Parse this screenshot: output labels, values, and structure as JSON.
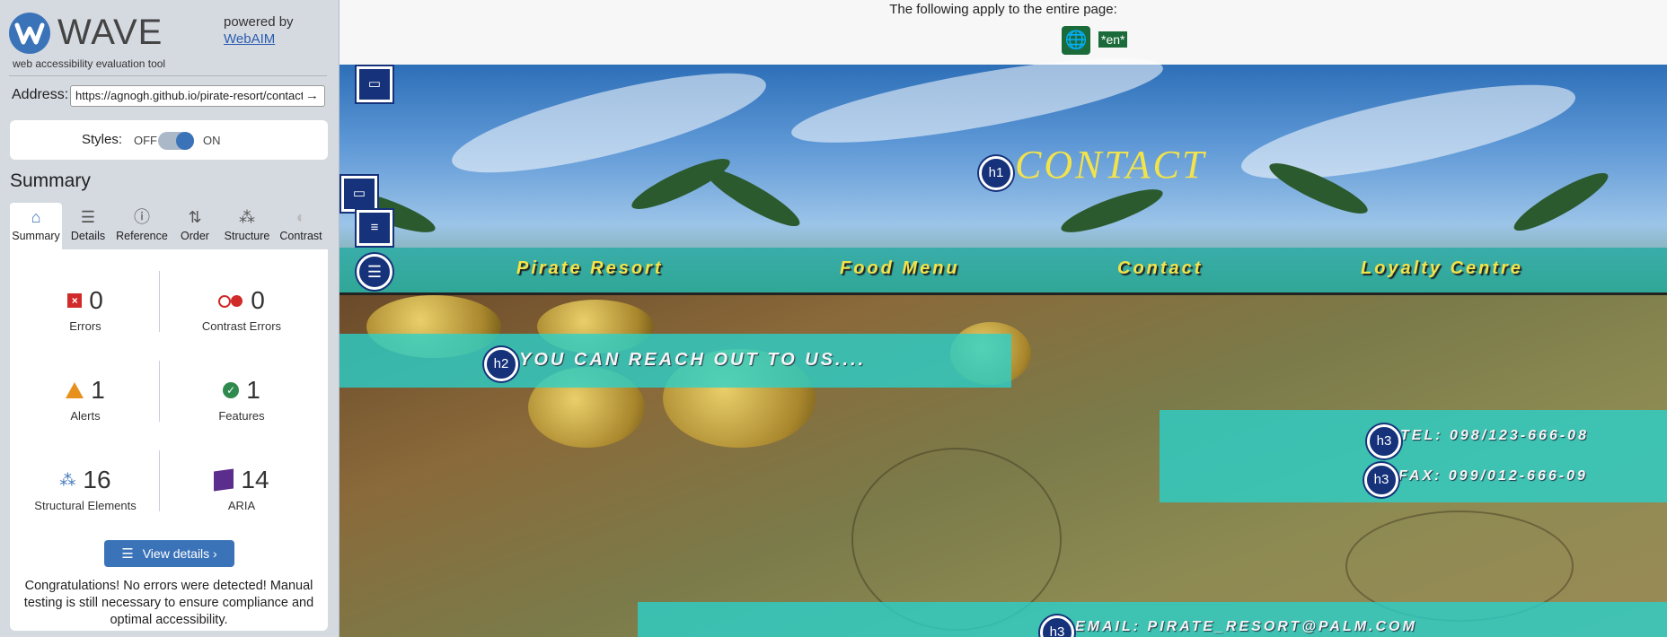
{
  "wave": {
    "logo_text": "WAVE",
    "tagline": "web accessibility evaluation tool",
    "powered_by": "powered by",
    "webaim_link": "WebAIM",
    "address_label": "Address:",
    "address_value": "https://agnogh.github.io/pirate-resort/contact",
    "go_icon": "→",
    "styles_label": "Styles:",
    "styles_off": "OFF",
    "styles_on": "ON",
    "summary_title": "Summary",
    "tabs": [
      {
        "label": "Summary",
        "icon": "⌂"
      },
      {
        "label": "Details",
        "icon": "☰"
      },
      {
        "label": "Reference",
        "icon": "ⓘ"
      },
      {
        "label": "Order",
        "icon": "⇅"
      },
      {
        "label": "Structure",
        "icon": "⁂"
      },
      {
        "label": "Contrast",
        "icon": "◐"
      }
    ],
    "stats": {
      "errors": {
        "count": "0",
        "label": "Errors"
      },
      "contrast": {
        "count": "0",
        "label": "Contrast Errors"
      },
      "alerts": {
        "count": "1",
        "label": "Alerts"
      },
      "features": {
        "count": "1",
        "label": "Features"
      },
      "structural": {
        "count": "16",
        "label": "Structural Elements"
      },
      "aria": {
        "count": "14",
        "label": "ARIA"
      }
    },
    "view_details": "View details ›",
    "congrats": "Congratulations! No errors were detected! Manual testing is still necessary to ensure compliance and optimal accessibility."
  },
  "page": {
    "apply_text": "The following apply to the entire page:",
    "lang_tag": "*en*",
    "title": "CONTACT",
    "nav": [
      "Pirate Resort",
      "Food Menu",
      "Contact",
      "Loyalty Centre"
    ],
    "reach_out": "YOU CAN REACH OUT TO US....",
    "tel": "TEL: 098/123-666-08",
    "fax": "FAX: 099/012-666-09",
    "email": "EMAIL: PIRATE_RESORT@PALM.COM",
    "badges": {
      "h1": "h1",
      "h2": "h2",
      "h3": "h3"
    }
  }
}
